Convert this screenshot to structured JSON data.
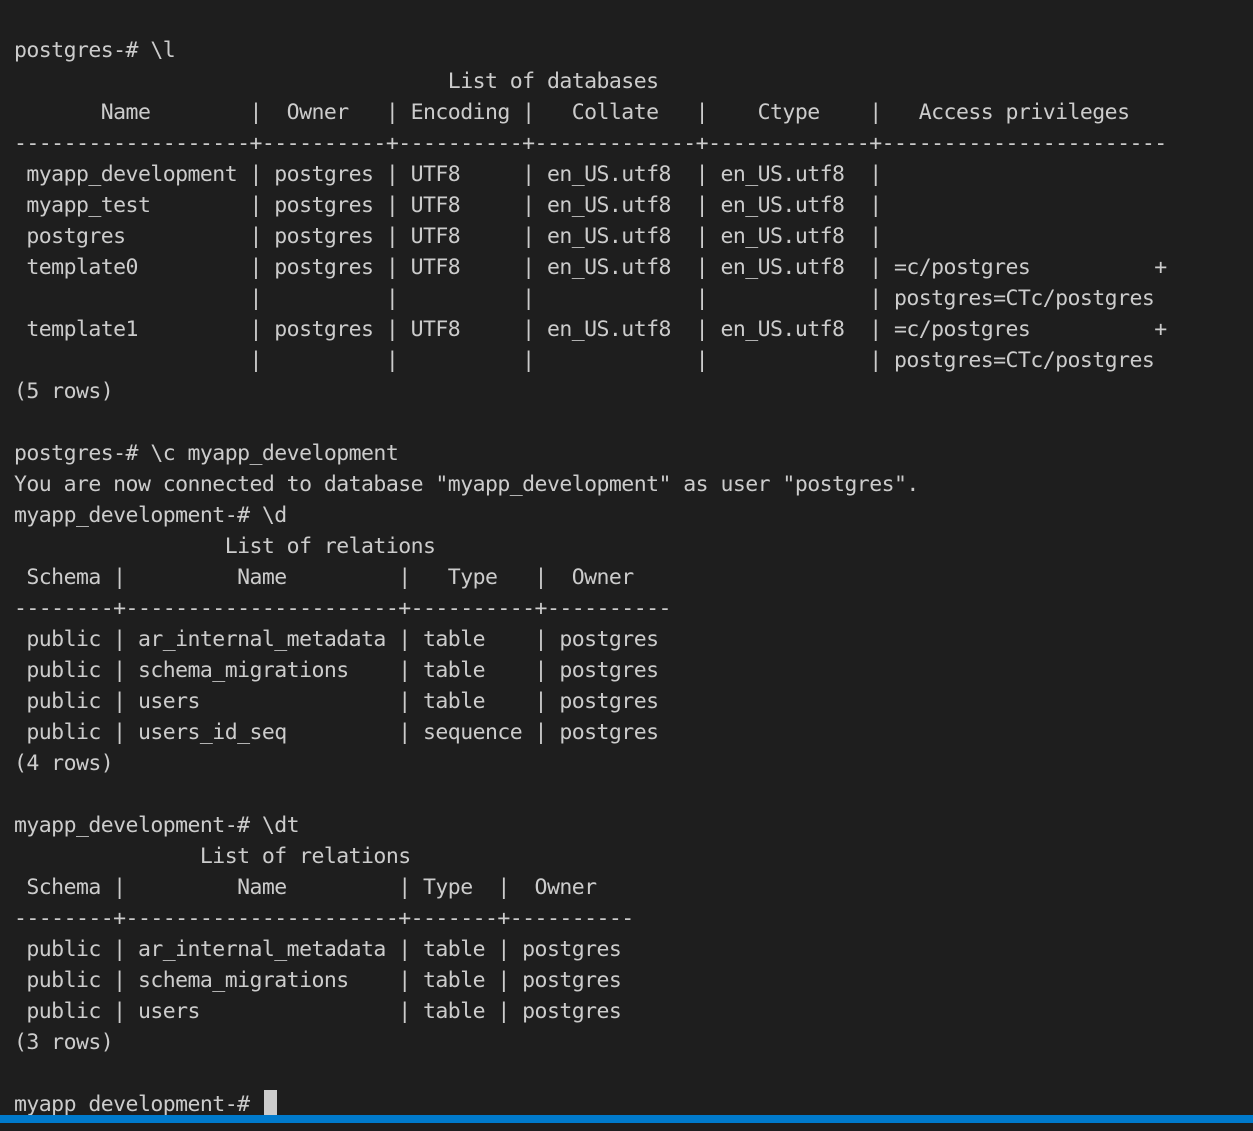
{
  "terminal": {
    "lines": [
      "",
      "postgres-# \\l",
      "                                   List of databases",
      "       Name        |  Owner   | Encoding |   Collate   |    Ctype    |   Access privileges",
      "-------------------+----------+----------+-------------+-------------+-----------------------",
      " myapp_development | postgres | UTF8     | en_US.utf8  | en_US.utf8  |",
      " myapp_test        | postgres | UTF8     | en_US.utf8  | en_US.utf8  |",
      " postgres          | postgres | UTF8     | en_US.utf8  | en_US.utf8  |",
      " template0         | postgres | UTF8     | en_US.utf8  | en_US.utf8  | =c/postgres          +",
      "                   |          |          |             |             | postgres=CTc/postgres",
      " template1         | postgres | UTF8     | en_US.utf8  | en_US.utf8  | =c/postgres          +",
      "                   |          |          |             |             | postgres=CTc/postgres",
      "(5 rows)",
      "",
      "postgres-# \\c myapp_development",
      "You are now connected to database \"myapp_development\" as user \"postgres\".",
      "myapp_development-# \\d",
      "                 List of relations",
      " Schema |         Name         |   Type   |  Owner",
      "--------+----------------------+----------+----------",
      " public | ar_internal_metadata | table    | postgres",
      " public | schema_migrations    | table    | postgres",
      " public | users                | table    | postgres",
      " public | users_id_seq         | sequence | postgres",
      "(4 rows)",
      "",
      "myapp_development-# \\dt",
      "               List of relations",
      " Schema |         Name         | Type  |  Owner",
      "--------+----------------------+-------+----------",
      " public | ar_internal_metadata | table | postgres",
      " public | schema_migrations    | table | postgres",
      " public | users                | table | postgres",
      "(3 rows)",
      ""
    ],
    "prompt": "myapp_development-# "
  },
  "colors": {
    "background": "#1e1e1e",
    "foreground": "#cccccc",
    "statusbar": "#007acc"
  }
}
